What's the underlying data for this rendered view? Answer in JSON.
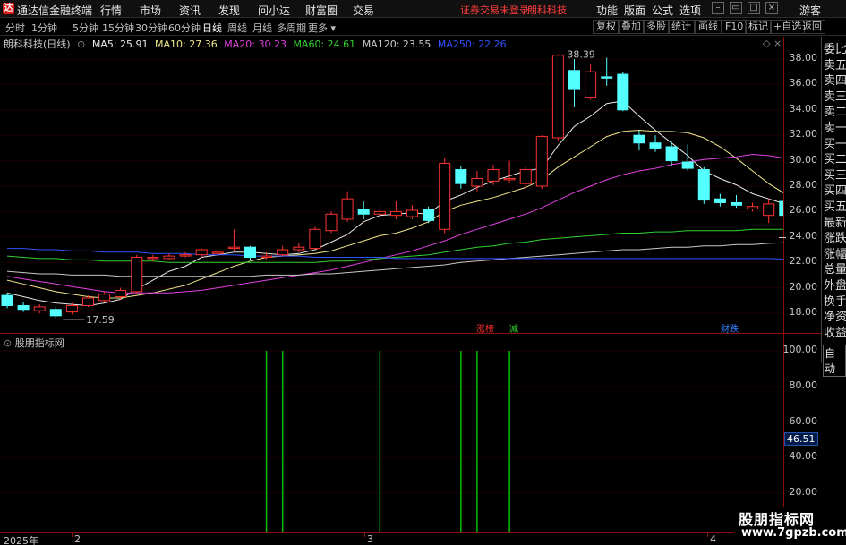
{
  "titlebar": {
    "logo_text": "达",
    "app_title": "通达信金融终端",
    "menus": [
      "行情",
      "市场",
      "资讯",
      "发现",
      "问小达",
      "财富圈",
      "交易"
    ],
    "notice": "证券交易未登录",
    "stock_name": "朗科科技",
    "right_menus": [
      "功能",
      "版面",
      "公式",
      "选项"
    ],
    "guest_label": "游客",
    "icon_colors": {
      "logo": "#e01818",
      "notice": "#ff3c3c"
    }
  },
  "periodbar": {
    "periods": [
      "分时",
      "1分钟",
      "5分钟",
      "15分钟",
      "30分钟",
      "60分钟",
      "日线",
      "周线",
      "月线",
      "多周期",
      "更多"
    ],
    "active_period": "日线",
    "tools": [
      "复权",
      "叠加",
      "多股",
      "统计",
      "画线",
      "F10",
      "标记",
      "+自选",
      "返回"
    ]
  },
  "ma_legend": {
    "title": "朗科科技(日线)",
    "items": [
      {
        "label": "MA5: 25.91",
        "color": "#e8e8e8"
      },
      {
        "label": "MA10: 27.36",
        "color": "#f0e68c"
      },
      {
        "label": "MA20: 30.23",
        "color": "#e040e0"
      },
      {
        "label": "MA60: 24.61",
        "color": "#30d030"
      },
      {
        "label": "MA120: 23.55",
        "color": "#c8c8c8"
      },
      {
        "label": "MA250: 22.26",
        "color": "#3050ff"
      }
    ]
  },
  "main_axis": {
    "ticks": [
      "38.00",
      "36.00",
      "34.00",
      "32.00",
      "30.00",
      "28.00",
      "26.00",
      "24.00",
      "22.00",
      "20.00",
      "18.00"
    ]
  },
  "annotations": {
    "high_label": "38.39",
    "low_label": "17.59",
    "tag_limit_up": "涨榜",
    "tag_reduce": "减",
    "tag_finance": "财跌"
  },
  "side_panel": {
    "items": [
      "委比",
      "卖五",
      "卖四",
      "卖三",
      "卖二",
      "卖一",
      "买一",
      "买二",
      "买三",
      "买四",
      "买五",
      "最新",
      "涨跌",
      "涨幅",
      "总量",
      "外盘",
      "换手",
      "净资",
      "收益"
    ],
    "auto_label": "自动"
  },
  "sub_chart": {
    "title": "股朋指标网",
    "ticks": [
      "100.00",
      "80.00",
      "60.00",
      "40.00",
      "20.00"
    ],
    "current_value": "46.51"
  },
  "time_axis": {
    "labels": [
      "2025年",
      "2",
      "3",
      "4"
    ]
  },
  "watermark": {
    "line1": "股朋指标网",
    "line2": "www.7gpzb.com"
  },
  "chart_data": [
    {
      "type": "candlestick",
      "title": "朗科科技(日线)",
      "ylim": [
        17,
        39.5
      ],
      "candles": [
        [
          19.4,
          18.6,
          19.6,
          18.4
        ],
        [
          18.6,
          18.3,
          18.9,
          18.1
        ],
        [
          18.2,
          18.5,
          18.7,
          18.0
        ],
        [
          18.3,
          17.8,
          18.5,
          17.6
        ],
        [
          18.1,
          18.6,
          18.8,
          17.9
        ],
        [
          18.6,
          19.2,
          19.4,
          18.5
        ],
        [
          19.0,
          19.5,
          19.7,
          18.9
        ],
        [
          19.3,
          19.8,
          20.0,
          19.1
        ],
        [
          19.7,
          22.4,
          22.6,
          19.6
        ],
        [
          22.3,
          22.4,
          22.6,
          22.1
        ],
        [
          22.3,
          22.5,
          22.7,
          22.2
        ],
        [
          22.5,
          22.6,
          22.8,
          22.4
        ],
        [
          22.6,
          23.0,
          23.1,
          22.4
        ],
        [
          22.7,
          22.8,
          23.0,
          22.5
        ],
        [
          23.1,
          23.2,
          24.6,
          22.9
        ],
        [
          23.2,
          22.4,
          23.3,
          22.2
        ],
        [
          22.4,
          22.5,
          22.8,
          22.2
        ],
        [
          22.6,
          23.0,
          23.3,
          22.5
        ],
        [
          23.0,
          23.2,
          23.5,
          22.8
        ],
        [
          23.1,
          24.6,
          24.8,
          23.0
        ],
        [
          24.5,
          25.8,
          26.0,
          24.3
        ],
        [
          25.4,
          27.0,
          27.6,
          25.2
        ],
        [
          26.2,
          25.8,
          26.8,
          25.4
        ],
        [
          25.8,
          26.0,
          26.4,
          25.5
        ],
        [
          25.7,
          26.0,
          26.8,
          25.4
        ],
        [
          25.6,
          26.1,
          26.5,
          25.4
        ],
        [
          26.2,
          25.3,
          26.4,
          25.1
        ],
        [
          24.6,
          29.8,
          30.2,
          24.3
        ],
        [
          29.3,
          28.2,
          29.6,
          27.8
        ],
        [
          28.0,
          28.6,
          29.2,
          27.6
        ],
        [
          28.4,
          29.3,
          29.7,
          28.1
        ],
        [
          28.5,
          28.6,
          30.0,
          28.3
        ],
        [
          28.2,
          29.3,
          29.6,
          27.8
        ],
        [
          28.0,
          31.9,
          32.0,
          27.8
        ],
        [
          31.8,
          38.3,
          38.39,
          31.6
        ],
        [
          37.1,
          35.6,
          38.0,
          34.2
        ],
        [
          35.0,
          37.0,
          37.6,
          34.8
        ],
        [
          36.6,
          36.5,
          38.1,
          35.9
        ],
        [
          36.8,
          34.0,
          37.0,
          33.9
        ],
        [
          32.0,
          31.4,
          32.4,
          30.8
        ],
        [
          31.4,
          31.0,
          32.0,
          30.7
        ],
        [
          31.1,
          30.0,
          31.5,
          29.6
        ],
        [
          29.9,
          29.4,
          31.3,
          29.2
        ],
        [
          29.3,
          26.9,
          29.5,
          26.6
        ],
        [
          27.0,
          26.7,
          27.4,
          26.4
        ],
        [
          26.7,
          26.5,
          27.3,
          26.3
        ],
        [
          26.2,
          26.4,
          26.7,
          26.0
        ],
        [
          25.7,
          26.6,
          27.0,
          25.1
        ],
        [
          26.8,
          25.7,
          26.9,
          25.6
        ]
      ],
      "ma_series": [
        {
          "name": "MA5",
          "color": "#e8e8e8",
          "values": [
            19.6,
            19.3,
            19.0,
            18.8,
            18.7,
            18.6,
            18.8,
            19.1,
            19.9,
            20.6,
            21.3,
            21.7,
            22.4,
            22.6,
            22.8,
            22.8,
            22.7,
            22.6,
            22.7,
            23.0,
            23.6,
            24.2,
            25.2,
            25.7,
            25.8,
            25.9,
            25.8,
            26.8,
            27.3,
            27.9,
            28.4,
            28.8,
            29.2,
            29.4,
            31.2,
            32.7,
            33.5,
            34.5,
            34.7,
            33.5,
            32.4,
            31.4,
            30.4,
            29.2,
            28.6,
            28.1,
            27.4,
            27.0,
            26.6
          ]
        },
        {
          "name": "MA10",
          "color": "#f0e68c",
          "values": [
            20.6,
            20.3,
            20.0,
            19.7,
            19.5,
            19.3,
            19.2,
            19.2,
            19.4,
            19.6,
            19.9,
            20.2,
            20.7,
            21.2,
            21.7,
            22.1,
            22.4,
            22.5,
            22.6,
            22.7,
            22.9,
            23.3,
            23.7,
            24.1,
            24.3,
            24.7,
            25.2,
            26.0,
            26.5,
            26.8,
            27.1,
            27.5,
            27.9,
            28.5,
            29.5,
            30.3,
            31.1,
            31.9,
            32.3,
            32.4,
            32.3,
            32.3,
            32.2,
            31.8,
            31.1,
            30.2,
            29.2,
            28.2,
            27.4
          ]
        },
        {
          "name": "MA20",
          "color": "#e040e0",
          "values": [
            20.9,
            20.7,
            20.5,
            20.3,
            20.1,
            19.9,
            19.7,
            19.6,
            19.6,
            19.6,
            19.6,
            19.7,
            19.8,
            20.0,
            20.2,
            20.4,
            20.6,
            20.8,
            21.0,
            21.2,
            21.4,
            21.7,
            22.0,
            22.3,
            22.6,
            22.9,
            23.3,
            23.7,
            24.2,
            24.6,
            25.0,
            25.4,
            25.8,
            26.3,
            26.9,
            27.5,
            28.0,
            28.5,
            28.9,
            29.2,
            29.4,
            29.7,
            29.9,
            30.1,
            30.2,
            30.3,
            30.5,
            30.4,
            30.2
          ]
        },
        {
          "name": "MA60",
          "color": "#30d030",
          "values": [
            22.5,
            22.4,
            22.3,
            22.3,
            22.2,
            22.2,
            22.1,
            22.1,
            22.1,
            22.1,
            22.0,
            22.0,
            22.0,
            22.0,
            22.0,
            22.0,
            22.0,
            22.0,
            22.0,
            22.0,
            22.1,
            22.1,
            22.2,
            22.3,
            22.4,
            22.5,
            22.6,
            22.8,
            23.0,
            23.2,
            23.3,
            23.5,
            23.6,
            23.8,
            23.9,
            24.0,
            24.1,
            24.2,
            24.3,
            24.3,
            24.4,
            24.4,
            24.5,
            24.5,
            24.5,
            24.5,
            24.6,
            24.6,
            24.6
          ]
        },
        {
          "name": "MA120",
          "color": "#c8c8c8",
          "values": [
            21.3,
            21.2,
            21.1,
            21.1,
            21.0,
            21.0,
            21.0,
            20.9,
            20.9,
            20.9,
            20.9,
            20.9,
            20.9,
            20.9,
            20.9,
            20.9,
            21.0,
            21.0,
            21.0,
            21.1,
            21.1,
            21.2,
            21.3,
            21.4,
            21.5,
            21.6,
            21.7,
            21.8,
            22.0,
            22.1,
            22.2,
            22.3,
            22.4,
            22.5,
            22.6,
            22.7,
            22.8,
            22.9,
            23.0,
            23.0,
            23.1,
            23.2,
            23.2,
            23.3,
            23.3,
            23.4,
            23.4,
            23.5,
            23.55
          ]
        },
        {
          "name": "MA250",
          "color": "#3050ff",
          "values": [
            23.1,
            23.1,
            23.0,
            23.0,
            22.9,
            22.9,
            22.8,
            22.8,
            22.8,
            22.7,
            22.7,
            22.7,
            22.6,
            22.6,
            22.6,
            22.5,
            22.5,
            22.5,
            22.5,
            22.4,
            22.4,
            22.4,
            22.4,
            22.4,
            22.3,
            22.3,
            22.3,
            22.3,
            22.3,
            22.3,
            22.3,
            22.3,
            22.3,
            22.3,
            22.3,
            22.3,
            22.3,
            22.3,
            22.3,
            22.3,
            22.3,
            22.3,
            22.3,
            22.3,
            22.3,
            22.3,
            22.3,
            22.3,
            22.26
          ]
        }
      ]
    },
    {
      "type": "bar",
      "title": "股朋指标网",
      "ylim": [
        0,
        110
      ],
      "signal_bars": [
        {
          "index": 16,
          "value": 100
        },
        {
          "index": 17,
          "value": 100
        },
        {
          "index": 23,
          "value": 100
        },
        {
          "index": 28,
          "value": 100
        },
        {
          "index": 29,
          "value": 100
        },
        {
          "index": 31,
          "value": 100
        }
      ],
      "color": "#00c000"
    }
  ]
}
